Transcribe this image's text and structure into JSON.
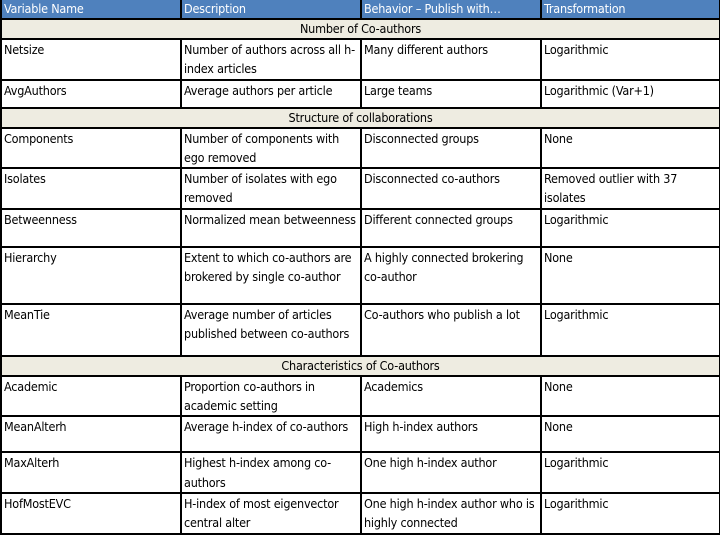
{
  "table": {
    "headers": [
      "Variable Name",
      "Description",
      "Behavior – Publish with…",
      "Transformation"
    ],
    "sections": [
      {
        "title": "Number of Co-authors",
        "rows": [
          {
            "variable": "Netsize",
            "description": "Number of authors across all h-index articles",
            "behavior": "Many different authors",
            "transformation": "Logarithmic"
          },
          {
            "variable": "AvgAuthors",
            "description": "Average authors per article",
            "behavior": "Large teams",
            "transformation": "Logarithmic (Var+1)"
          }
        ]
      },
      {
        "title": "Structure of collaborations",
        "rows": [
          {
            "variable": "Components",
            "description": "Number of components with ego removed",
            "behavior": "Disconnected groups",
            "transformation": "None"
          },
          {
            "variable": "Isolates",
            "description": "Number of isolates with ego removed",
            "behavior": "Disconnected co-authors",
            "transformation": "Removed outlier with 37 isolates"
          },
          {
            "variable": "Betweenness",
            "description": "Normalized mean betweenness",
            "behavior": "Different connected groups",
            "transformation": "Logarithmic"
          },
          {
            "variable": "Hierarchy",
            "description": "Extent to which co-authors are brokered by single co-author",
            "behavior": "A highly connected brokering co-author",
            "transformation": "None"
          },
          {
            "variable": "MeanTie",
            "description": "Average number of articles published between co-authors",
            "behavior": "Co-authors who publish a lot",
            "transformation": "Logarithmic"
          }
        ]
      },
      {
        "title": "Characteristics of Co-authors",
        "rows": [
          {
            "variable": "Academic",
            "description": "Proportion co-authors in academic setting",
            "behavior": "Academics",
            "transformation": "None"
          },
          {
            "variable": "MeanAlterh",
            "description": "Average h-index of co-authors",
            "behavior": "High h-index authors",
            "transformation": "None"
          },
          {
            "variable": "MaxAlterh",
            "description": "Highest h-index among co-authors",
            "behavior": "One high h-index author",
            "transformation": "Logarithmic"
          },
          {
            "variable": "HofMostEVC",
            "description": "H-index of most eigenvector central alter",
            "behavior": "One high h-index author who is highly connected",
            "transformation": "Logarithmic"
          }
        ]
      }
    ]
  },
  "colors": {
    "header_bg": "#4f81bd",
    "header_text": "#ffffff",
    "section_bg": "#eeece1",
    "border": "#000000"
  }
}
